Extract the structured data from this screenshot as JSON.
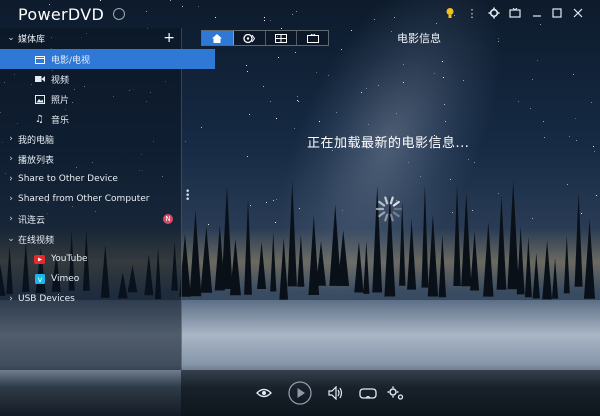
{
  "app": {
    "title": "PowerDVD"
  },
  "titlebar": {
    "icons": [
      "bulb-icon",
      "gear-icon",
      "display-icon",
      "minimize-icon",
      "maximize-icon",
      "close-icon"
    ],
    "accent": "#f2c21b"
  },
  "sidebar": {
    "library": {
      "label": "媒体库",
      "items": [
        {
          "label": "电影/电视",
          "icon": "movie-icon",
          "active": true
        },
        {
          "label": "视频",
          "icon": "video-icon"
        },
        {
          "label": "照片",
          "icon": "photo-icon"
        },
        {
          "label": "音乐",
          "icon": "music-icon"
        }
      ]
    },
    "sections": [
      {
        "label": "我的电脑"
      },
      {
        "label": "播放列表"
      },
      {
        "label": "Share to Other Device"
      },
      {
        "label": "Shared from Other Computer"
      },
      {
        "label": "讯连云",
        "badge": "N"
      }
    ],
    "online": {
      "label": "在线视频",
      "items": [
        {
          "label": "YouTube",
          "icon": "youtube-icon"
        },
        {
          "label": "Vimeo",
          "icon": "vimeo-icon"
        }
      ]
    },
    "usb": {
      "label": "USB Devices"
    },
    "accent": "#2f78d6"
  },
  "tabs": [
    "home-icon",
    "disc-icon",
    "film-icon",
    "tv-icon"
  ],
  "main": {
    "section_title": "电影信息",
    "loading_text": "正在加载最新的电影信息..."
  },
  "controls": [
    "eye-icon",
    "play-icon",
    "volume-icon",
    "vr-icon",
    "settings-icon"
  ]
}
